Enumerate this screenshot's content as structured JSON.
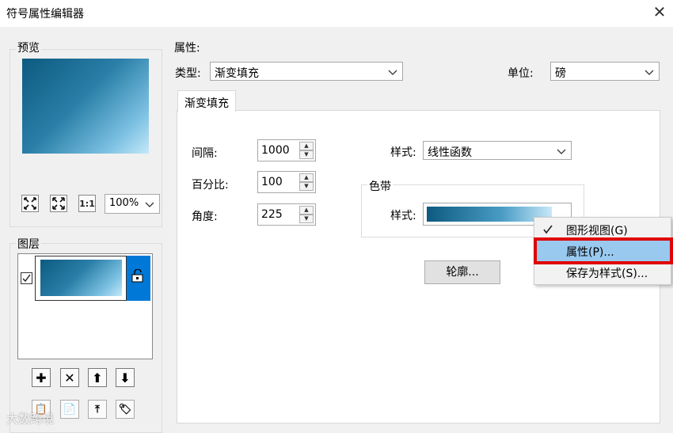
{
  "window": {
    "title": "符号属性编辑器",
    "close_glyph": "✕"
  },
  "preview": {
    "label": "预览",
    "zoom_value": "100%",
    "buttons": [
      "fit-extent",
      "full-extent",
      "1:1"
    ]
  },
  "layers": {
    "label": "图层"
  },
  "properties": {
    "label": "属性:",
    "type_label": "类型:",
    "type_value": "渐变填充",
    "unit_label": "单位:",
    "unit_value": "磅",
    "tab_label": "渐变填充",
    "interval_label": "间隔:",
    "interval_value": "1000",
    "percent_label": "百分比:",
    "percent_value": "100",
    "angle_label": "角度:",
    "angle_value": "225",
    "style_label": "样式:",
    "style_value": "线性函数",
    "colorband_label": "色带",
    "colorband_style_label": "样式:",
    "outline_button": "轮廓..."
  },
  "context_menu": {
    "items": [
      "图形视图(G)",
      "属性(P)...",
      "保存为样式(S)..."
    ],
    "checked_index": 0,
    "highlighted_index": 1
  },
  "watermark": "大数跨境",
  "colors": {
    "highlight": "#99c9ef",
    "red_outline": "#e00000",
    "selected_layer": "#0078d7"
  }
}
